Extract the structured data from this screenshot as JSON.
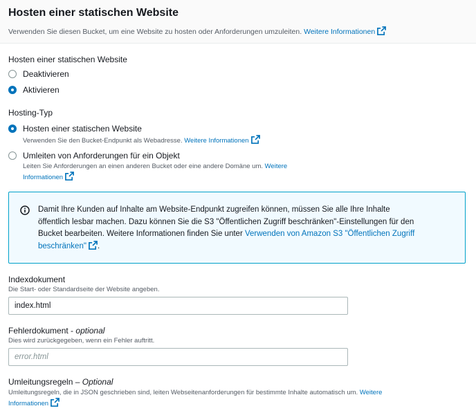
{
  "header": {
    "title": "Hosten einer statischen Website",
    "description": "Verwenden Sie diesen Bucket, um eine Website zu hosten oder Anforderungen umzuleiten.",
    "learn_more": "Weitere Informationen"
  },
  "static_hosting": {
    "label": "Hosten einer statischen Website",
    "options": [
      {
        "label": "Deaktivieren",
        "checked": false
      },
      {
        "label": "Aktivieren",
        "checked": true
      }
    ]
  },
  "hosting_type": {
    "label": "Hosting-Typ",
    "options": [
      {
        "label": "Hosten einer statischen Website",
        "description": "Verwenden Sie den Bucket-Endpunkt als Webadresse.",
        "learn_more": "Weitere Informationen",
        "checked": true
      },
      {
        "label": "Umleiten von Anforderungen für ein Objekt",
        "description_line1": "Leiten Sie Anforderungen an einen anderen Bucket oder eine andere Domäne um.",
        "learn_more_part1": "Weitere",
        "learn_more_part2": "Informationen",
        "checked": false
      }
    ]
  },
  "info_box": {
    "line1": "Damit Ihre Kunden auf Inhalte am Website-Endpunkt zugreifen können, müssen Sie alle Ihre Inhalte",
    "line2": "öffentlich lesbar machen. Dazu können Sie die S3 \"Öffentlichen Zugriff beschränken\"-Einstellungen für den",
    "line3_text": "Bucket bearbeiten. Weitere Informationen finden Sie unter ",
    "line3_link": "Verwenden von Amazon S3 \"Öffentlichen Zugriff",
    "line4_link": "beschränken\"",
    "line4_end": "."
  },
  "index_document": {
    "label": "Indexdokument",
    "description": "Die Start- oder Standardseite der Website angeben.",
    "value": "index.html"
  },
  "error_document": {
    "label": "Fehlerdokument",
    "optional": "optional",
    "description": "Dies wird zurückgegeben, wenn ein Fehler auftritt.",
    "placeholder": "error.html"
  },
  "redirect_rules": {
    "label": "Umleitungsregeln – ",
    "optional": "Optional",
    "description": "Umleitungsregeln, die in JSON geschrieben sind, leiten Webseitenanforderungen für bestimmte Inhalte automatisch um.",
    "learn_more_part1": "Weitere",
    "learn_more_part2": "Informationen"
  },
  "colors": {
    "link": "#0073bb",
    "radio_checked": "#0073bb",
    "info_border": "#00a1c9",
    "info_bg": "#f1faff"
  }
}
